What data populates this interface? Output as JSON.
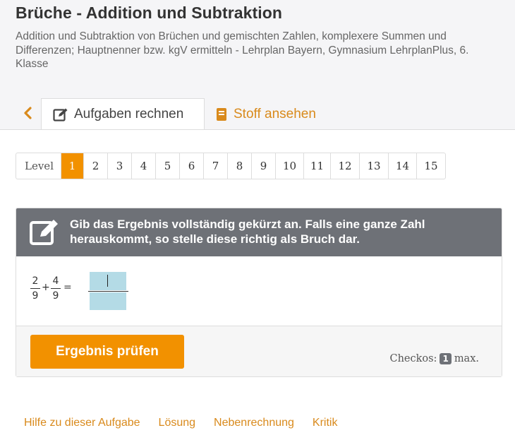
{
  "page": {
    "title": "Brüche - Addition und Subtraktion",
    "subtitle": "Addition und Subtraktion von Brüchen und gemischten Zahlen, komplexere Summen und Differenzen; Hauptnenner bzw. kgV ermitteln - Lehrplan Bayern, Gymnasium LehrplanPlus, 6. Klasse"
  },
  "tabs": {
    "back_icon": "chevron-left-icon",
    "active": {
      "label": "Aufgaben rechnen",
      "icon": "edit-icon"
    },
    "inactive": {
      "label": "Stoff ansehen",
      "icon": "book-icon"
    }
  },
  "pager": {
    "label": "Level",
    "current": "1",
    "levels": [
      "1",
      "2",
      "3",
      "4",
      "5",
      "6",
      "7",
      "8",
      "9",
      "10",
      "11",
      "12",
      "13",
      "14",
      "15"
    ]
  },
  "task": {
    "instruction": "Gib das Ergebnis vollständig gekürzt an. Falls eine ganze Zahl herauskommt, so stelle diese richtig als Bruch dar.",
    "frac1": {
      "num": "2",
      "den": "9"
    },
    "operator": "+",
    "frac2": {
      "num": "4",
      "den": "9"
    },
    "equals": "=",
    "answer_numerator": "",
    "answer_denominator": ""
  },
  "footer": {
    "check_button": "Ergebnis prüfen",
    "checkos_label": "Checkos:",
    "checkos_count": "1",
    "checkos_suffix": "max."
  },
  "links": [
    "Hilfe zu dieser Aufgabe",
    "Lösung",
    "Nebenrechnung",
    "Kritik"
  ],
  "colors": {
    "accent": "#f29100",
    "link": "#d98a1c",
    "header_bar": "#6e7177",
    "input_bg": "#b4dbe6"
  }
}
